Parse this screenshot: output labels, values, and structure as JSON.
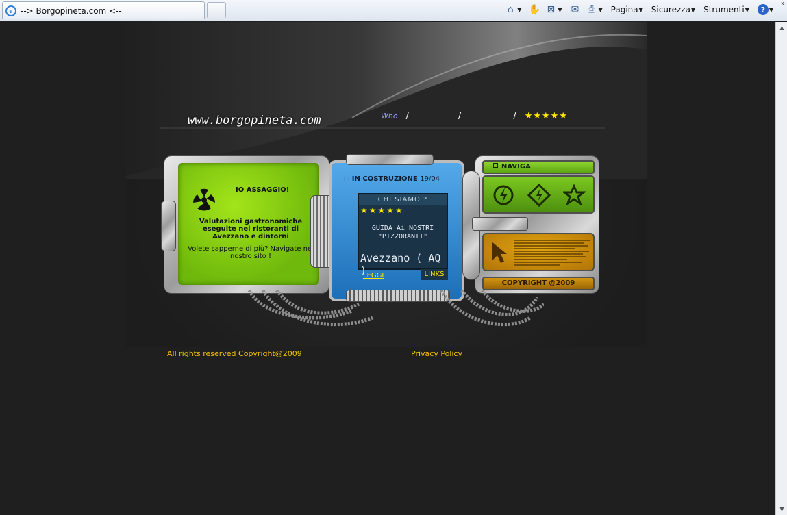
{
  "browser": {
    "tab_title": "--> Borgopineta.com <--",
    "menu": {
      "pagina": "Pagina",
      "sicurezza": "Sicurezza",
      "strumenti": "Strumenti"
    }
  },
  "header": {
    "site_name": "www.borgopineta.com",
    "nav_who": "Who",
    "nav_sep": "/",
    "nav_stars": "★★★★★"
  },
  "left_panel": {
    "title": "IO ASSAGGIO!",
    "description": "Valutazioni gastronomiche eseguite nei ristoranti di Avezzano e dintorni",
    "more": "Volete sapperne di più? Navigate nel nostro sito !"
  },
  "center_panel": {
    "title": "IN COSTRUZIONE",
    "date": "19/04",
    "box_title": "CHI SIAMO ?",
    "stars": "★★★★★",
    "guide_line1": "GUIDA Ai NOSTRI",
    "guide_line2": "\"PIZZORANTI\"",
    "city": "Avezzano ( AQ )",
    "leggi": "LEGGI",
    "links": "LINKS"
  },
  "right_panel": {
    "naviga": "NAVIGA",
    "copyright": "COPYRIGHT @2009"
  },
  "footer": {
    "rights": "All rights reserved Copyright@2009",
    "privacy": "Privacy Policy"
  },
  "colors": {
    "background": "#1f1f1f",
    "green_screen": "#8fd41a",
    "blue_panel": "#3a92d8",
    "orange_panel": "#d3960f",
    "footer_text": "#f1c400",
    "stars": "#ffe800"
  }
}
